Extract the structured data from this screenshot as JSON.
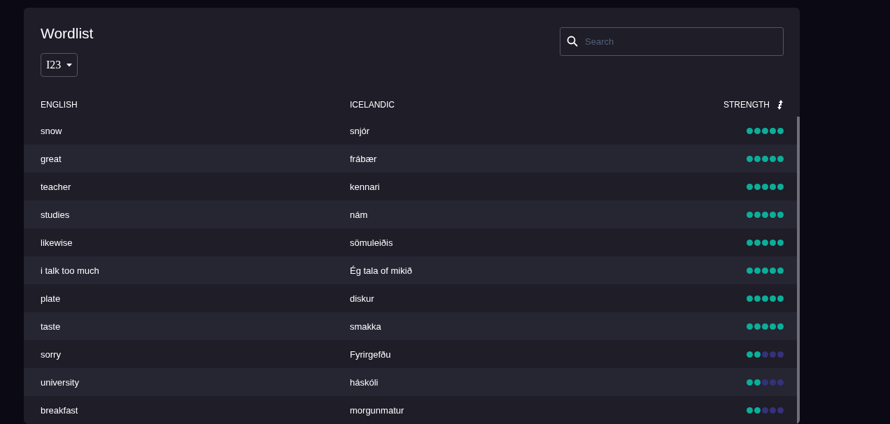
{
  "title": "Wordlist",
  "deck_select": {
    "value": "I23"
  },
  "search": {
    "placeholder": "Search"
  },
  "table": {
    "columns": [
      "ENGLISH",
      "ICELANDIC",
      "STRENGTH"
    ],
    "rows": [
      {
        "english": "snow",
        "icelandic": "snjór",
        "stars": 5
      },
      {
        "english": "great",
        "icelandic": "frábær",
        "stars": 5
      },
      {
        "english": "teacher",
        "icelandic": "kennari",
        "stars": 5
      },
      {
        "english": "studies",
        "icelandic": "nám",
        "stars": 5
      },
      {
        "english": "likewise",
        "icelandic": "sömuleiðis",
        "stars": 5
      },
      {
        "english": "i talk too much",
        "icelandic": "Ég tala of mikið",
        "stars": 5
      },
      {
        "english": "plate",
        "icelandic": "diskur",
        "stars": 5
      },
      {
        "english": "taste",
        "icelandic": "smakka",
        "stars": 5
      },
      {
        "english": "sorry",
        "icelandic": "Fyrirgefðu",
        "stars": 2
      },
      {
        "english": "university",
        "icelandic": "háskóli",
        "stars": 2
      },
      {
        "english": "breakfast",
        "icelandic": "morgunmatur",
        "stars": 2
      }
    ]
  }
}
